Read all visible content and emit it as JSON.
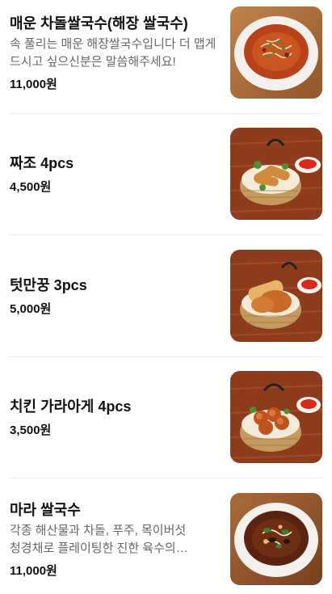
{
  "menu": {
    "items": [
      {
        "name": "매운 차돌쌀국수(해장 쌀국수)",
        "description": "속 풀리는 매운 해장쌀국수입니다 더 맵게 드시고 싶으신분은 말씀해주세요!",
        "price": "11,000원",
        "image": "spicy-pho-bowl-photo"
      },
      {
        "name": "짜조 4pcs",
        "description": "",
        "price": "4,500원",
        "image": "spring-rolls-basket-photo"
      },
      {
        "name": "텃만꿍 3pcs",
        "description": "",
        "price": "5,000원",
        "image": "shrimp-cake-basket-photo"
      },
      {
        "name": "치킨 가라아게 4pcs",
        "description": "",
        "price": "3,500원",
        "image": "karaage-basket-photo"
      },
      {
        "name": "마라 쌀국수",
        "description": "각종 해산물과 차돌, 푸주, 목이버섯 청경채로 플레이팅한 진한 육수의 마라쌀국수",
        "price": "11,000원",
        "image": "mala-pho-bowl-photo"
      }
    ]
  },
  "colors": {
    "text": "#111111",
    "description": "#666666",
    "divider": "#eeeeee",
    "table_wood": "#8a3a1c"
  }
}
